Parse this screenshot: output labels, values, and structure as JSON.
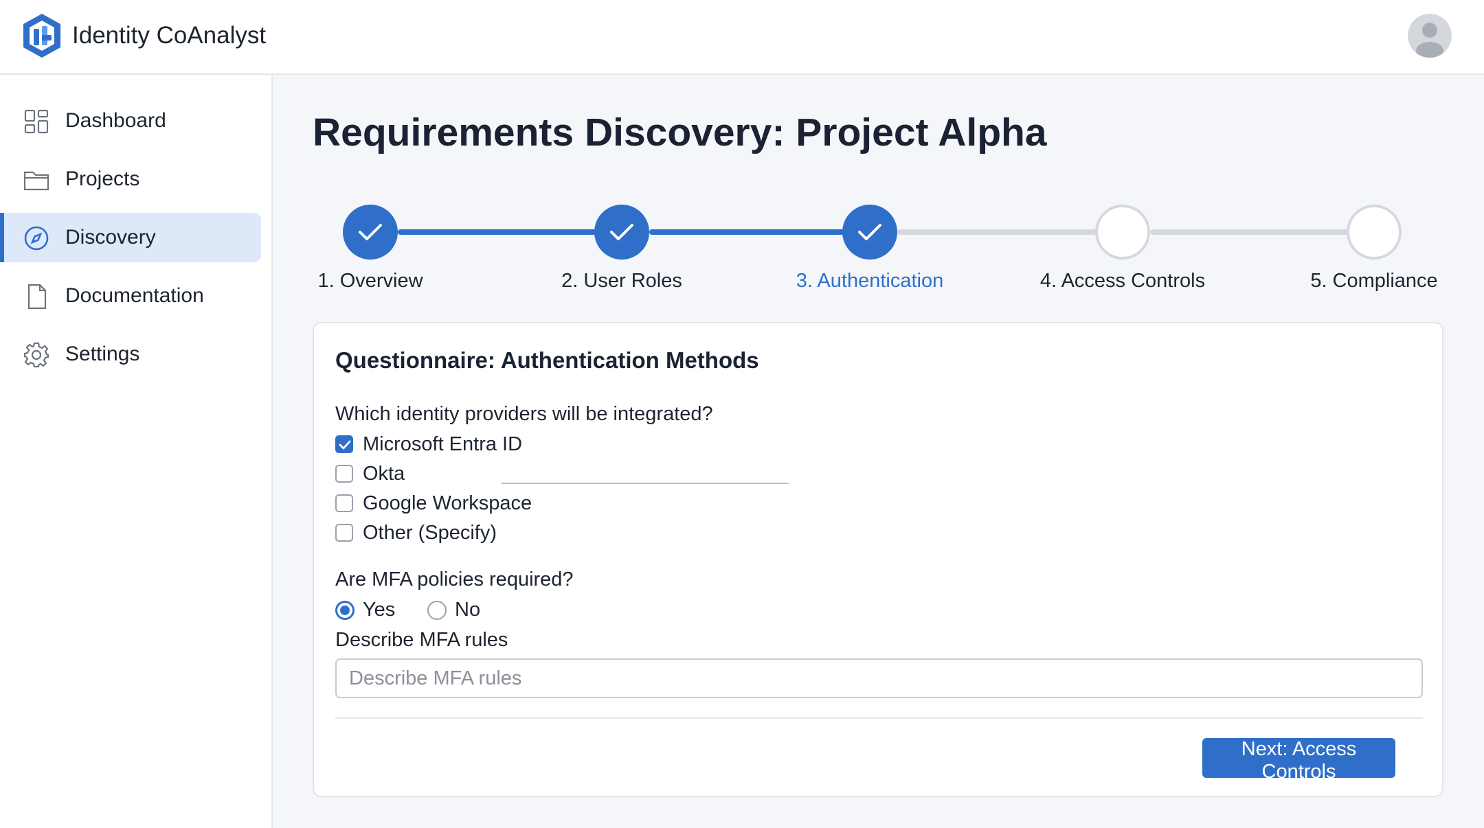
{
  "app": {
    "title": "Identity CoAnalyst"
  },
  "colors": {
    "accent": "#2f6fc9",
    "active_nav_bg": "#dde9f9",
    "pending_step": "#d5d9df"
  },
  "sidebar": {
    "items": [
      {
        "label": "Dashboard",
        "icon": "dashboard-grid-icon",
        "active": false
      },
      {
        "label": "Projects",
        "icon": "folder-icon",
        "active": false
      },
      {
        "label": "Discovery",
        "icon": "compass-icon",
        "active": true
      },
      {
        "label": "Documentation",
        "icon": "document-icon",
        "active": false
      },
      {
        "label": "Settings",
        "icon": "gear-icon",
        "active": false
      }
    ]
  },
  "main": {
    "title": "Requirements Discovery: Project Alpha"
  },
  "stepper": {
    "steps": [
      {
        "label": "1. Overview",
        "status": "complete"
      },
      {
        "label": "2. User Roles",
        "status": "complete"
      },
      {
        "label": "3. Authentication",
        "status": "current"
      },
      {
        "label": "4. Access Controls",
        "status": "pending"
      },
      {
        "label": "5. Compliance",
        "status": "pending"
      }
    ]
  },
  "questionnaire": {
    "title": "Questionnaire: Authentication Methods",
    "q1": {
      "label": "Which identity providers will be integrated?",
      "options": [
        {
          "label": "Microsoft Entra ID",
          "checked": true
        },
        {
          "label": "Okta",
          "checked": false
        },
        {
          "label": "Google Workspace",
          "checked": false
        },
        {
          "label": "Other (Specify)",
          "checked": false
        }
      ]
    },
    "q2": {
      "label": "Are MFA policies required?",
      "options": [
        {
          "label": "Yes",
          "selected": true
        },
        {
          "label": "No",
          "selected": false
        }
      ]
    },
    "mfa_rules": {
      "label": "Describe MFA rules",
      "placeholder": "Describe MFA rules",
      "value": ""
    },
    "next_button": "Next: Access Controls"
  }
}
